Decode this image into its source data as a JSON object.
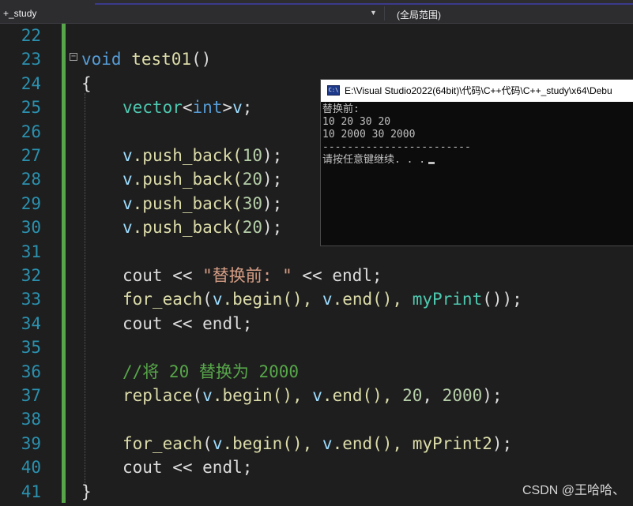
{
  "toolbar": {
    "project": "+_study",
    "scope": "(全局范围)"
  },
  "editor": {
    "line_numbers": [
      "22",
      "23",
      "24",
      "25",
      "26",
      "27",
      "28",
      "29",
      "30",
      "31",
      "32",
      "33",
      "34",
      "35",
      "36",
      "37",
      "38",
      "39",
      "40",
      "41"
    ],
    "code": {
      "l23_kw": "void",
      "l23_fn": "test01",
      "l23_rest": "()",
      "l24": "{",
      "l25_cls": "vector",
      "l25_lt": "<",
      "l25_kw": "int",
      "l25_gt": ">",
      "l25_var": "v",
      "l25_end": ";",
      "v": "v",
      "push_back": ".push_back(",
      "close": ");",
      "n10": "10",
      "n20": "20",
      "n30": "30",
      "n2000": "2000",
      "cout": "cout",
      "shl": " << ",
      "str_before": "\"替换前: \"",
      "endl": "endl",
      "semi": ";",
      "for_each": "for_each",
      "open": "(",
      "begin": ".begin(), ",
      "end": ".end(), ",
      "myPrint": "myPrint",
      "myPrint_close": "());",
      "comment": "//将 20 替换为 2000",
      "replace": "replace",
      "comma": ", ",
      "myPrint2": "myPrint2",
      "l41": "}"
    }
  },
  "console": {
    "title": "E:\\Visual Studio2022(64bit)\\代码\\C++代码\\C++_study\\x64\\Debu",
    "lines": [
      "替换前:",
      "10 20 30 20",
      "10 2000 30 2000",
      "------------------------",
      "请按任意键继续. . ."
    ]
  },
  "watermark": "CSDN @王哈哈、"
}
